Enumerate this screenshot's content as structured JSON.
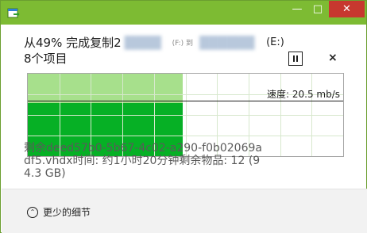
{
  "window": {
    "title": "",
    "minimize_icon": "minimize-icon",
    "maximize_icon": "maximize-icon",
    "close_icon": "close-icon"
  },
  "header": {
    "status_text": "从49% 完成复制2",
    "source_drive": "(F:) 到",
    "dest_drive": "(E:)",
    "items_text": "8个项目"
  },
  "controls": {
    "pause_icon": "pause-icon",
    "close_symbol": "×"
  },
  "graph": {
    "progress": 0.49,
    "speed_text": "速度: 20.5 mb/s",
    "colors": {
      "completed_light": "#a7e08c",
      "throughput_dark": "#06b025"
    }
  },
  "details": {
    "text": "剩余deed57b0-5b67-4c02-a290-f0b02069adf5.vhdx时间: 约1小时20分钟剩余物品: 12 (94.3 GB)"
  },
  "footer": {
    "toggle_label": "更少的细节",
    "toggle_icon": "chevron-up-icon"
  },
  "colors": {
    "titlebar": "#7dbb33",
    "close_button": "#c7382f"
  }
}
